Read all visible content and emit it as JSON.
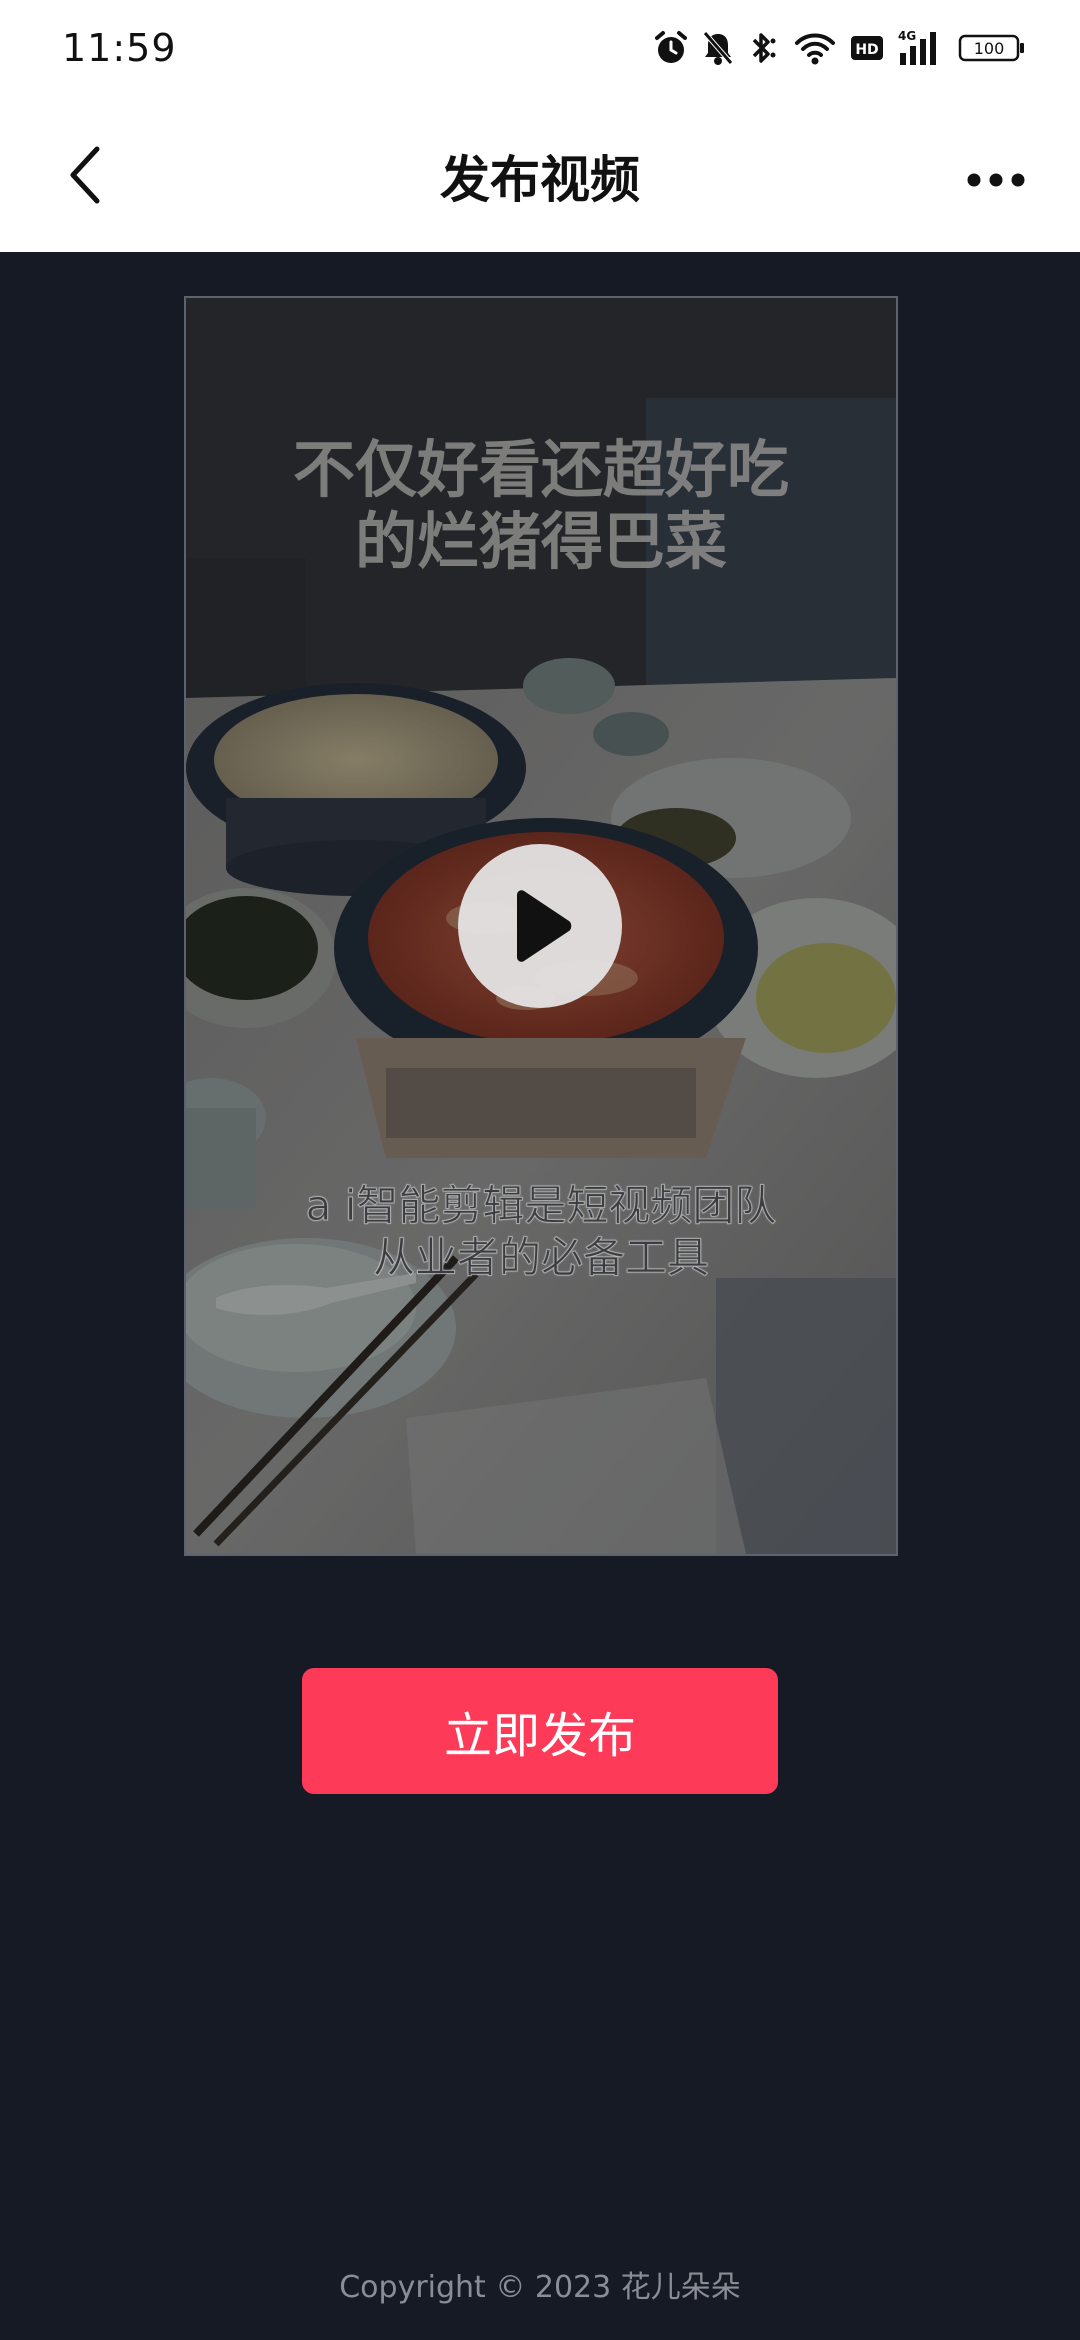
{
  "status_bar": {
    "time": "11:59",
    "network": "4G",
    "hd_label": "HD",
    "battery": "100",
    "icons": [
      "alarm-icon",
      "bell-off-icon",
      "bluetooth-icon",
      "wifi-icon",
      "hd-icon",
      "signal-icon",
      "battery-icon"
    ]
  },
  "nav": {
    "title": "发布视频",
    "back_icon": "chevron-left-icon",
    "more_icon": "more-horizontal-icon"
  },
  "video": {
    "title_line1": "不仅好看还超好吃",
    "title_line2": "的烂猪得巴菜",
    "subtitle": "a i智能剪辑是短视频团队从业者的必备工具",
    "play_icon": "play-icon"
  },
  "actions": {
    "publish_label": "立即发布"
  },
  "footer": {
    "copyright": "Copyright © 2023 花儿朵朵"
  },
  "colors": {
    "background": "#161a25",
    "accent": "#fe3a59",
    "header": "#ffffff"
  }
}
